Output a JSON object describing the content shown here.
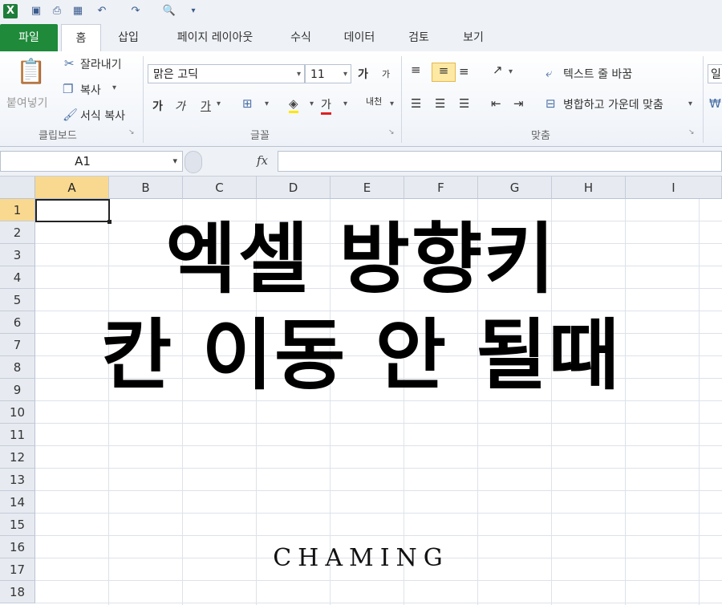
{
  "qat": {
    "icons": [
      "excel-icon",
      "save-icon",
      "print-icon",
      "calc-icon",
      "undo-icon",
      "redo-icon",
      "print-preview-icon",
      "customize-icon"
    ]
  },
  "tabs": [
    "파일",
    "홈",
    "삽입",
    "페이지 레이아웃",
    "수식",
    "데이터",
    "검토",
    "보기"
  ],
  "clipboard": {
    "paste": "붙여넣기",
    "cut": "잘라내기",
    "copy": "복사",
    "format_painter": "서식 복사",
    "group": "클립보드"
  },
  "font": {
    "family": "맑은 고딕",
    "size": "11",
    "grow": "가",
    "shrink": "가",
    "bold": "가",
    "italic": "가",
    "underline": "가",
    "font_color": "가",
    "phonetic": "내천",
    "group": "글꼴"
  },
  "alignment": {
    "wrap_text": "텍스트 줄 바꿈",
    "merge_center": "병합하고 가운데 맞춤",
    "group": "맞춤"
  },
  "number": {
    "partial": "일"
  },
  "formula_bar": {
    "name_box": "A1",
    "fx": "fx"
  },
  "columns": [
    "A",
    "B",
    "C",
    "D",
    "E",
    "F",
    "G",
    "H",
    "I"
  ],
  "rows": [
    "1",
    "2",
    "3",
    "4",
    "5",
    "6",
    "7",
    "8",
    "9",
    "10",
    "11",
    "12",
    "13",
    "14",
    "15",
    "16",
    "17",
    "18"
  ],
  "overlay": {
    "line1": "엑셀 방향키",
    "line2": "칸 이동 안 될때",
    "brand": "CHAMING"
  },
  "colors": {
    "file_tab": "#1e8a3a",
    "selected_header": "#f9d98f",
    "grid_line": "#dde2ea"
  }
}
